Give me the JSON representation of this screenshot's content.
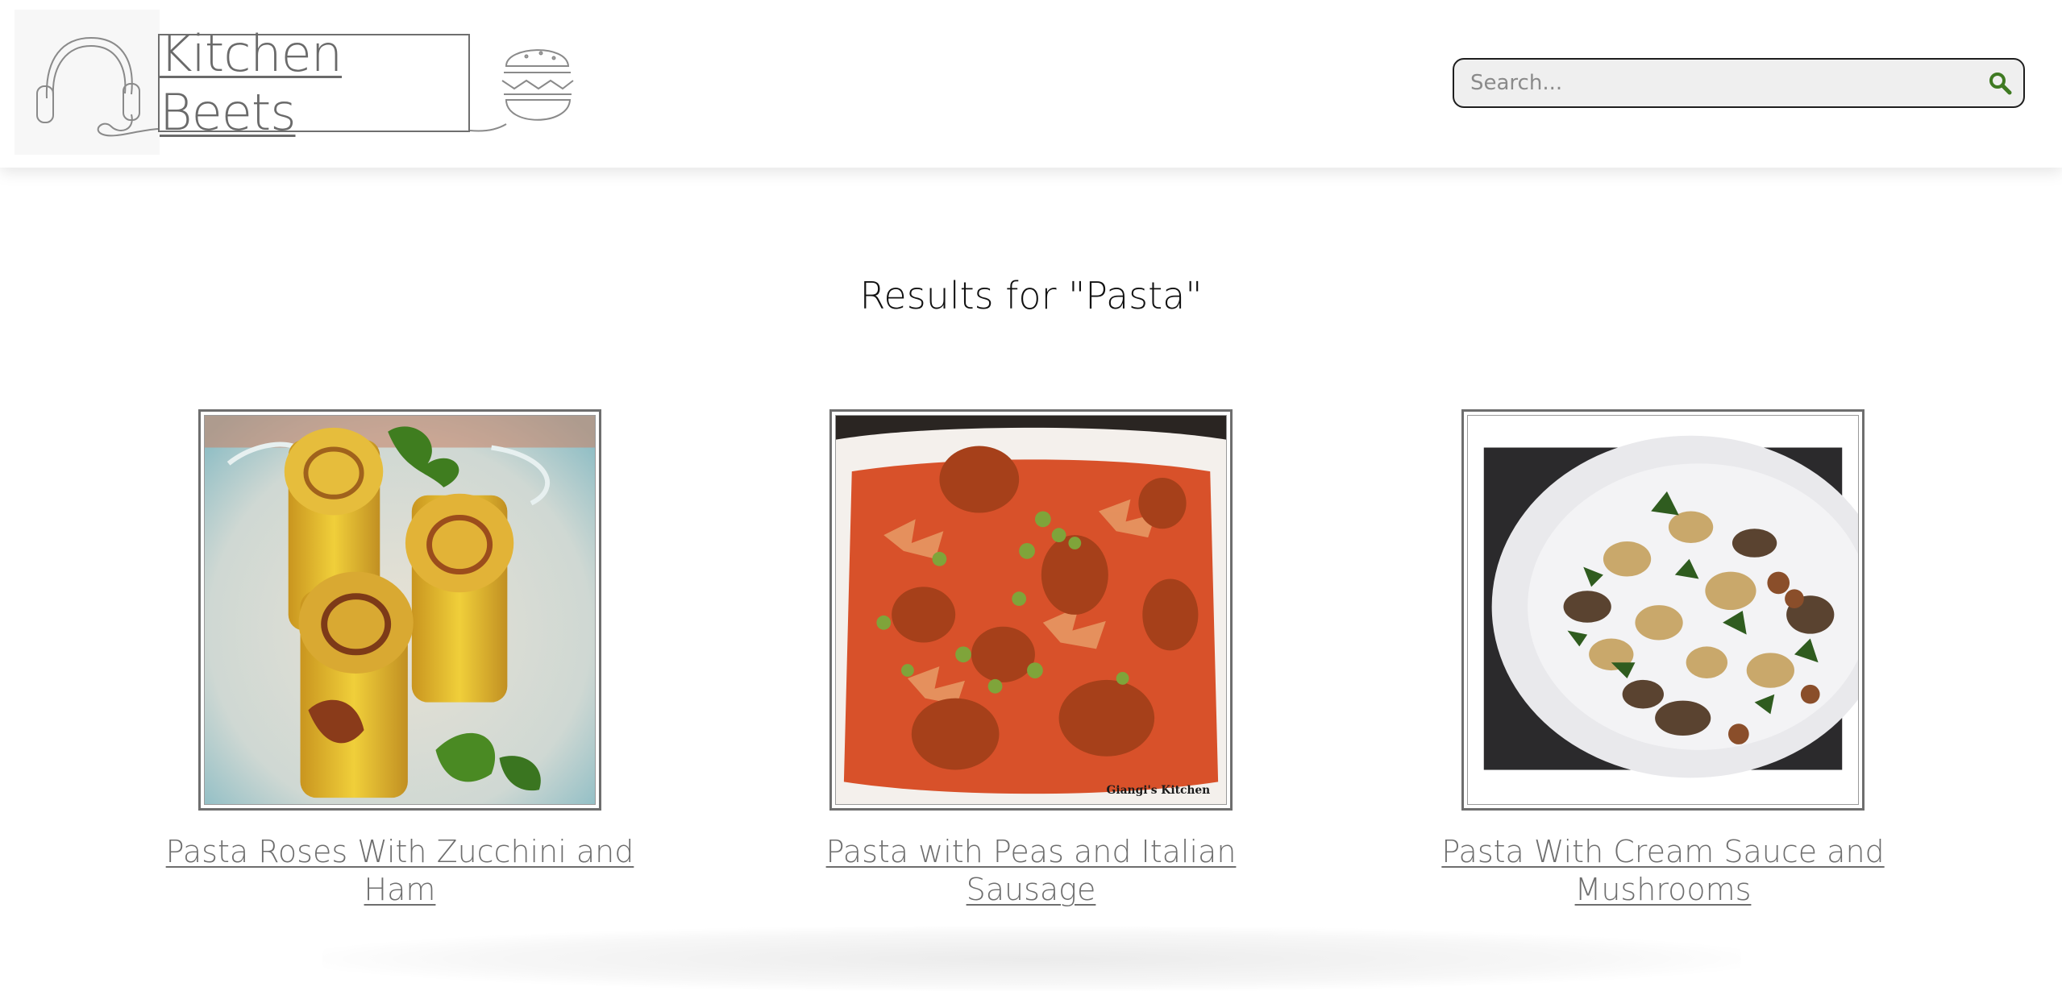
{
  "header": {
    "logo_text": "Kitchen Beets",
    "logo_left_icon": "headphones-doodle-icon",
    "logo_right_icon": "burger-doodle-icon",
    "search": {
      "placeholder": "Search...",
      "icon": "search-icon",
      "icon_color": "#3f7a22"
    }
  },
  "main": {
    "results_title": "Results for \"Pasta\"",
    "results": [
      {
        "title": "Pasta Roses With Zucchini and Ham"
      },
      {
        "title": "Pasta with Peas and Italian Sausage",
        "image_watermark": "Giangi's Kitchen"
      },
      {
        "title": "Pasta With Cream Sauce and Mushrooms"
      }
    ]
  },
  "colors": {
    "logo_gray": "#6a6a6a",
    "link_gray": "#6e6e6e",
    "search_bg": "#efefef",
    "search_border": "#1e1e1e",
    "search_icon": "#3f7a22"
  }
}
